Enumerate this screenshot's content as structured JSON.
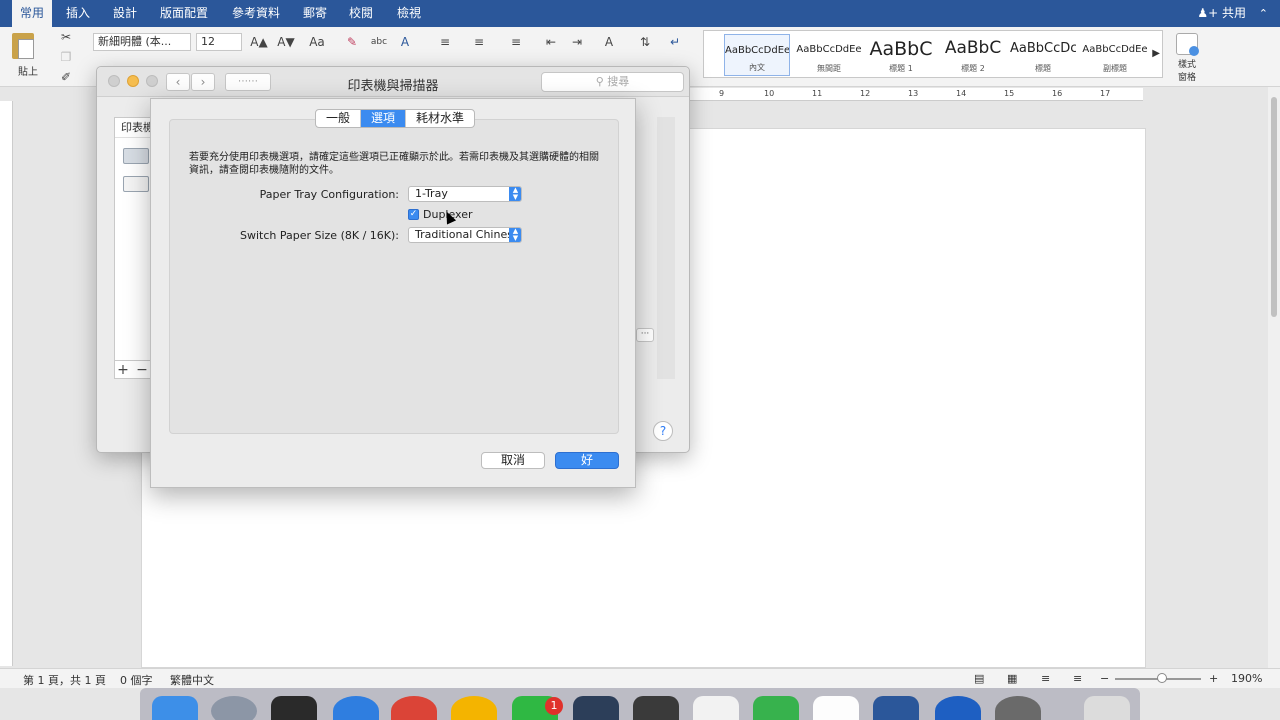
{
  "ribbon": {
    "tabs": [
      "常用",
      "插入",
      "設計",
      "版面配置",
      "參考資料",
      "郵寄",
      "校閱",
      "檢視"
    ],
    "share_label": "共用",
    "paste_label": "貼上",
    "font_name": "新細明體 (本...",
    "font_size": "12",
    "styles": [
      {
        "sample": "AaBbCcDdEe",
        "name": "內文"
      },
      {
        "sample": "AaBbCcDdEe",
        "name": "無間距"
      },
      {
        "sample": "AaBbC",
        "name": "標題 1"
      },
      {
        "sample": "AaBbC",
        "name": "標題 2"
      },
      {
        "sample": "AaBbCcDc",
        "name": "標題"
      },
      {
        "sample": "AaBbCcDdEe",
        "name": "副標題"
      }
    ],
    "style_pane_label": "樣式窗格"
  },
  "ruler": {
    "ticks": [
      "9",
      "10",
      "11",
      "12",
      "13",
      "14",
      "15",
      "16",
      "17"
    ]
  },
  "status": {
    "page": "第 1 頁，共 1 頁",
    "words": "0 個字",
    "language": "繁體中文",
    "zoom": "190%",
    "zoom_fraction": 0.55
  },
  "printers_window": {
    "title": "印表機與掃描器",
    "search_placeholder": "搜尋",
    "list_header": "印表機",
    "add_label": "+",
    "remove_label": "−",
    "more_label": "···",
    "help_label": "?"
  },
  "options_sheet": {
    "tabs": [
      "一般",
      "選項",
      "耗材水準"
    ],
    "active_tab": "選項",
    "info_text": "若要充分使用印表機選項，請確定這些選項已正確顯示於此。若需印表機及其選購硬體的相關資訊，請查閱印表機隨附的文件。",
    "tray_label": "Paper Tray Configuration:",
    "tray_value": "1-Tray",
    "duplexer_label": "Duplexer",
    "duplexer_checked": true,
    "paper_size_label": "Switch Paper Size (8K / 16K):",
    "paper_size_value": "Traditional Chinese",
    "cancel_label": "取消",
    "ok_label": "好"
  },
  "dock": {
    "line_badge": "1"
  }
}
